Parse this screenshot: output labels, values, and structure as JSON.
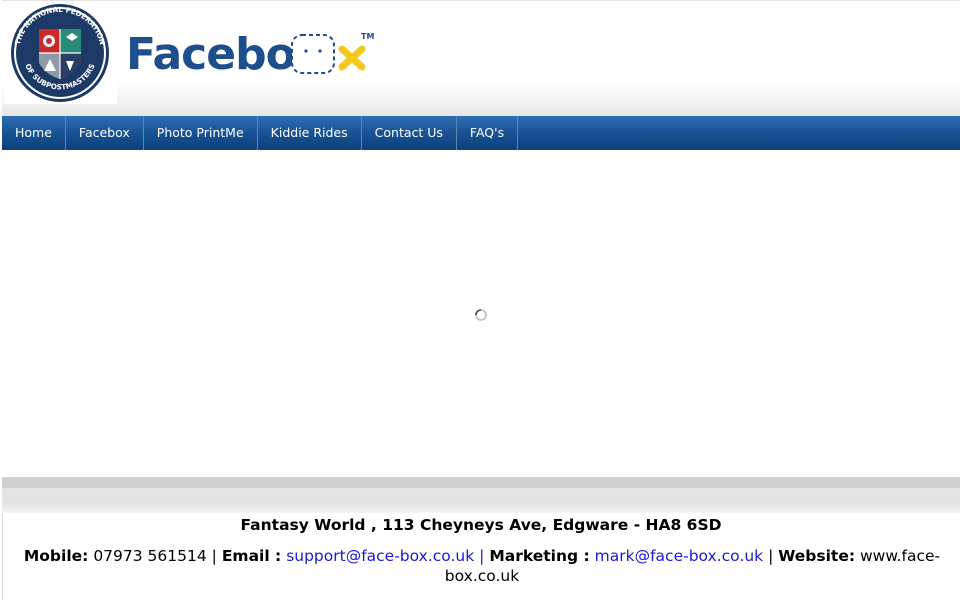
{
  "header": {
    "seal_text": "THE NATIONAL FEDERATION OF SUBPOSTMASTERS",
    "logo_text": "Facebox",
    "logo_tm": "TM"
  },
  "nav": {
    "items": [
      {
        "label": "Home"
      },
      {
        "label": "Facebox"
      },
      {
        "label": "Photo PrintMe"
      },
      {
        "label": "Kiddie Rides"
      },
      {
        "label": "Contact Us"
      },
      {
        "label": "FAQ's"
      }
    ]
  },
  "footer": {
    "address": "Fantasy World , 113 Cheyneys Ave, Edgware - HA8 6SD",
    "mobile_label": "Mobile:",
    "mobile_value": "07973 561514",
    "email_label": "Email :",
    "email_value": "support@face-box.co.uk",
    "marketing_label": "Marketing :",
    "marketing_value": "mark@face-box.co.uk",
    "website_label": "Website:",
    "website_value": "www.face-box.co.uk",
    "separator": "|"
  },
  "colors": {
    "nav_blue": "#1b5597",
    "logo_blue": "#1f4e8c",
    "logo_red": "#e3262a",
    "logo_yellow": "#f2c81c",
    "link": "#1a1ad6"
  },
  "icons": {
    "loading": "loading-spinner-icon"
  }
}
